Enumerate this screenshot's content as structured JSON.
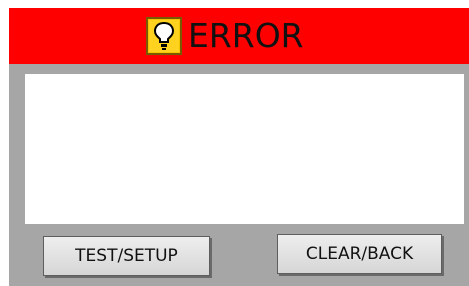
{
  "header": {
    "title": "ERROR",
    "icon": "warning-icon",
    "background_color": "#ff0000"
  },
  "message": {
    "text": ""
  },
  "buttons": {
    "test_setup_label": "TEST/SETUP",
    "clear_back_label": "CLEAR/BACK"
  }
}
